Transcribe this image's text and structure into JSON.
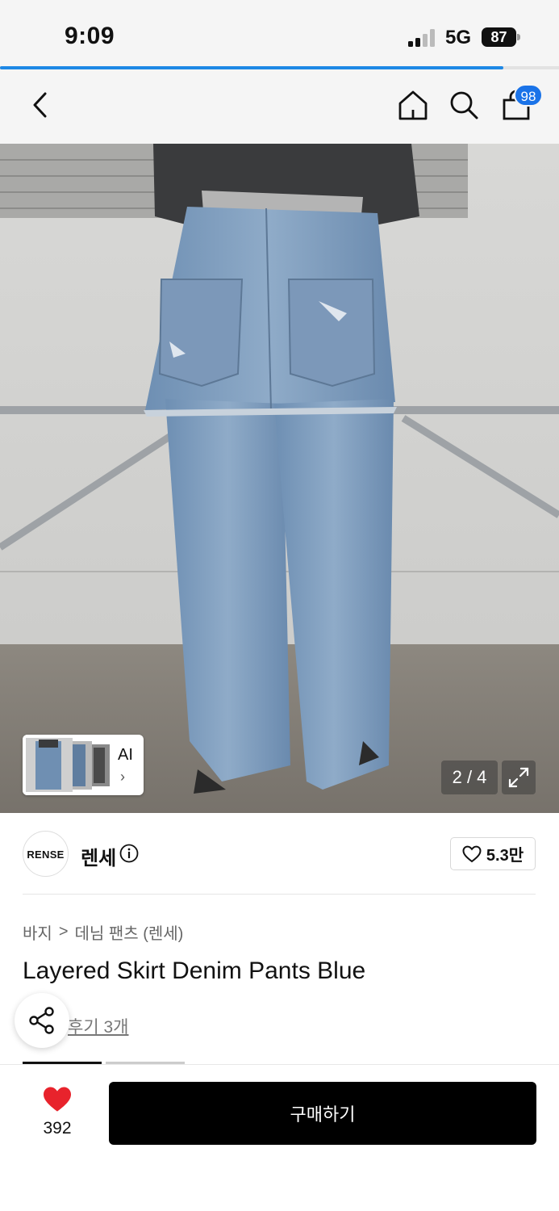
{
  "status_bar": {
    "time": "9:09",
    "network": "5G",
    "battery": "87",
    "page_load_progress": 0.9
  },
  "nav": {
    "back_icon": "chevron-left-icon",
    "home_icon": "home-icon",
    "search_icon": "search-icon",
    "cart_icon": "shopping-bag-icon",
    "cart_badge": "98",
    "badge_color": "#1a73e8"
  },
  "gallery": {
    "thumb_label": "AI",
    "thumb_arrow": "›",
    "counter": "2 / 4",
    "expand_icon": "expand-icon"
  },
  "brand": {
    "logo_text": "RENSE",
    "name": "렌세",
    "info_icon": "info-icon",
    "like_icon": "heart-outline-icon",
    "like_count": "5.3만"
  },
  "product": {
    "breadcrumb": [
      "바지",
      "데님 팬츠 (렌세)"
    ],
    "breadcrumb_separator": ">",
    "title": "Layered Skirt Denim Pants Blue",
    "review_link": "후기 3개",
    "share_icon": "share-icon"
  },
  "bottom_bar": {
    "wish_icon": "heart-filled-icon",
    "wish_color": "#e8232c",
    "wish_count": "392",
    "buy_label": "구매하기"
  }
}
